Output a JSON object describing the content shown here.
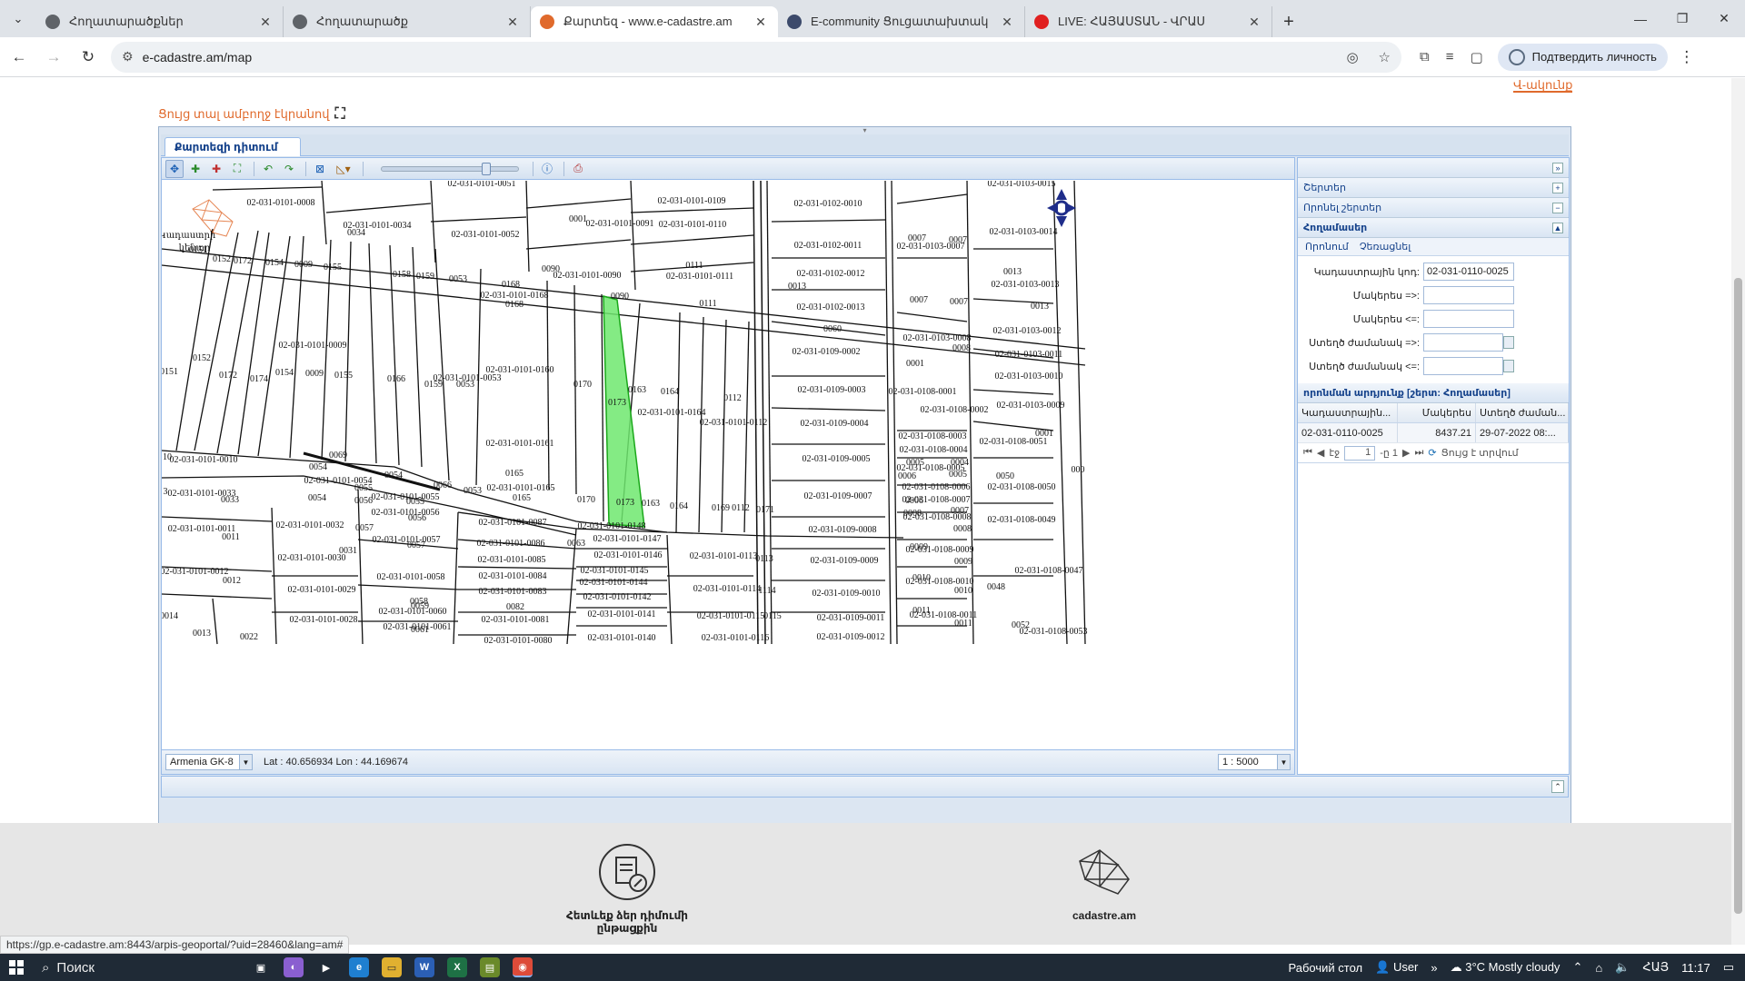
{
  "browser": {
    "tabs": [
      {
        "title": "Հողատարածքներ",
        "active": false,
        "color": "#5f6368"
      },
      {
        "title": "Հողատարածք",
        "active": false,
        "color": "#5f6368"
      },
      {
        "title": "Քարտեզ - www.e-cadastre.am",
        "active": true,
        "color": "#e06a2c"
      },
      {
        "title": "E-community Ցուցատախտակ",
        "active": false,
        "color": "#3c4a6b"
      },
      {
        "title": "LIVE: ՀԱՅԱՍՏԱՆ - ՎՐԱՍ",
        "active": false,
        "color": "#e02020"
      }
    ],
    "url": "e-cadastre.am/map",
    "verify_label": "Подтвердить личность",
    "status_url": "https://gp.e-cadastre.am:8443/arpis-geoportal/?uid=28460&lang=am#"
  },
  "page": {
    "top_link": "Վ-ակունք",
    "fullscreen_label": "Ցույց տալ ամբողջ էկրանով",
    "map_tab": "Քարտեզի դիտում",
    "projection": "Armenia GK-8",
    "latlon": "Lat : 40.656934  Lon : 44.169674",
    "scale": "1 : 5000"
  },
  "right_panel": {
    "sections": [
      {
        "label": "Շերտեր",
        "toggle": "+"
      },
      {
        "label": "Որոնել շերտեր",
        "toggle": "−"
      }
    ],
    "active_section": "Հողամասեր",
    "subtabs": [
      "Որոնում",
      "Չեռացնել"
    ],
    "fields": [
      {
        "label": "Կադաստրային կոդ:",
        "value": "02-031-0110-0025"
      },
      {
        "label": "Մակերես =>:",
        "value": ""
      },
      {
        "label": "Մակերես <=:",
        "value": ""
      },
      {
        "label": "Ստեղծ ժամանակ =>:",
        "value": ""
      },
      {
        "label": "Ստեղծ ժամանակ <=:",
        "value": ""
      }
    ],
    "results_title": "որոնման արդյունք [շերտ: Հողամասեր]",
    "columns": [
      "Կադաստրային...",
      "Մակերես",
      "Ստեղծ ժաման..."
    ],
    "rows": [
      [
        "02-031-0110-0025",
        "8437.21",
        "29-07-2022 08:..."
      ]
    ],
    "pager": {
      "page_label": "էջ",
      "page": "1",
      "of": "-ը 1",
      "status": "Ցույց է տրվում"
    }
  },
  "map": {
    "labels": [
      [
        "02-031-0101-0008",
        275,
        192
      ],
      [
        "02-031-0101-0051",
        496,
        171
      ],
      [
        "02-031-0101-0109",
        727,
        190
      ],
      [
        "02-031-0102-0010",
        877,
        193
      ],
      [
        "02-031-0103-0015",
        1090,
        171
      ],
      [
        "02-031-0101-0034",
        381,
        217
      ],
      [
        "0034",
        358,
        225
      ],
      [
        "0001",
        602,
        210
      ],
      [
        "02-031-0101-0091",
        648,
        215
      ],
      [
        "02-031-0101-0110",
        728,
        216
      ],
      [
        "02-031-0101-0052",
        500,
        227
      ],
      [
        "02-031-0103-0014",
        1092,
        224
      ],
      [
        "02-031-0102-0011",
        877,
        239
      ],
      [
        "0007",
        975,
        231
      ],
      [
        "0007",
        1020,
        233
      ],
      [
        "02-031-0103-0007",
        990,
        240
      ],
      [
        "0152",
        210,
        254
      ],
      [
        "0172",
        233,
        256
      ],
      [
        "0154",
        268,
        258
      ],
      [
        "0009",
        300,
        260
      ],
      [
        "0155",
        332,
        263
      ],
      [
        "0158",
        408,
        271
      ],
      [
        "0159",
        434,
        273
      ],
      [
        "0053",
        470,
        276
      ],
      [
        "0090",
        572,
        265
      ],
      [
        "02-031-0101-0090",
        612,
        272
      ],
      [
        "0111",
        730,
        261
      ],
      [
        "02-031-0101-0111",
        736,
        273
      ],
      [
        "02-031-0102-0012",
        880,
        270
      ],
      [
        "0013",
        1080,
        268
      ],
      [
        "0168",
        528,
        282
      ],
      [
        "02-031-0101-0168",
        532,
        294
      ],
      [
        "0168",
        532,
        304
      ],
      [
        "0090",
        648,
        295
      ],
      [
        "0111",
        745,
        303
      ],
      [
        "0013",
        843,
        284
      ],
      [
        "02-031-0103-0013",
        1094,
        282
      ],
      [
        "0007",
        977,
        299
      ],
      [
        "0007",
        1021,
        301
      ],
      [
        "02-031-0102-0013",
        880,
        307
      ],
      [
        "0013",
        1110,
        306
      ],
      [
        "02-031-0101-0009",
        310,
        349
      ],
      [
        "0060",
        882,
        331
      ],
      [
        "02-031-0103-0012",
        1096,
        333
      ],
      [
        "02-031-0103-0008",
        997,
        341
      ],
      [
        "0008",
        1024,
        352
      ],
      [
        "02-031-0109-0002",
        875,
        356
      ],
      [
        "0152",
        188,
        363
      ],
      [
        "0151",
        152,
        378
      ],
      [
        "0172",
        217,
        382
      ],
      [
        "0174",
        251,
        386
      ],
      [
        "0154",
        279,
        379
      ],
      [
        "0009",
        312,
        380
      ],
      [
        "0155",
        344,
        382
      ],
      [
        "0166",
        402,
        386
      ],
      [
        "02-031-0101-0160",
        538,
        376
      ],
      [
        "02-031-0101-0053",
        480,
        385
      ],
      [
        "0159",
        443,
        392
      ],
      [
        "0053",
        478,
        392
      ],
      [
        "02-031-0103-0011",
        1098,
        359
      ],
      [
        "0001",
        973,
        369
      ],
      [
        "02-031-0103-0010",
        1098,
        383
      ],
      [
        "0170",
        607,
        392
      ],
      [
        "0163",
        667,
        398
      ],
      [
        "0164",
        703,
        400
      ],
      [
        "0112",
        772,
        407
      ],
      [
        "02-031-0109-0003",
        881,
        398
      ],
      [
        "02-031-0108-0001",
        981,
        400
      ],
      [
        "0173",
        645,
        412
      ],
      [
        "02-031-0103-0009",
        1100,
        415
      ],
      [
        "02-031-0101-0164",
        705,
        423
      ],
      [
        "02-031-0101-0112",
        773,
        434
      ],
      [
        "02-031-0109-0004",
        884,
        435
      ],
      [
        "02-031-0108-0002",
        1016,
        420
      ],
      [
        "02-031-0108-0003",
        992,
        449
      ],
      [
        "02-031-0108-0004",
        993,
        464
      ],
      [
        "02-031-0101-0161",
        538,
        457
      ],
      [
        "0001",
        1115,
        446
      ],
      [
        "02-031-0108-0051",
        1081,
        455
      ],
      [
        "10",
        150,
        472
      ],
      [
        "02-031-0101-0010",
        190,
        475
      ],
      [
        "02-031-0109-0005",
        886,
        474
      ],
      [
        "0005",
        973,
        478
      ],
      [
        "0004",
        1022,
        478
      ],
      [
        "0069",
        338,
        470
      ],
      [
        "0054",
        316,
        483
      ],
      [
        "0054",
        399,
        492
      ],
      [
        "02-031-0101-0054",
        338,
        498
      ],
      [
        "0165",
        532,
        490
      ],
      [
        "02-031-0108-0005",
        990,
        484
      ],
      [
        "0050",
        1072,
        493
      ],
      [
        "0006",
        964,
        493
      ],
      [
        "0005",
        1020,
        491
      ],
      [
        "0055",
        366,
        506
      ],
      [
        "02-031-0101-0165",
        539,
        506
      ],
      [
        "0053",
        486,
        509
      ],
      [
        "02-031-0101-0033",
        188,
        512
      ],
      [
        "3",
        148,
        510
      ],
      [
        "0033",
        219,
        519
      ],
      [
        "02-031-0101-0055",
        412,
        516
      ],
      [
        "0066",
        453,
        503
      ],
      [
        "0054",
        315,
        517
      ],
      [
        "0056",
        366,
        520
      ],
      [
        "0055",
        423,
        521
      ],
      [
        "0165",
        540,
        517
      ],
      [
        "0170",
        611,
        519
      ],
      [
        "0173",
        654,
        522
      ],
      [
        "0163",
        682,
        523
      ],
      [
        "0164",
        713,
        526
      ],
      [
        "0169",
        759,
        528
      ],
      [
        "0112",
        781,
        528
      ],
      [
        "0171",
        808,
        530
      ],
      [
        "02-031-0109-0007",
        888,
        515
      ],
      [
        "02-031-0108-0006",
        996,
        505
      ],
      [
        "02-031-0108-0050",
        1090,
        505
      ],
      [
        "000",
        1152,
        486
      ],
      [
        "0007",
        1022,
        531
      ],
      [
        "02-031-0108-0007",
        996,
        519
      ],
      [
        "0006",
        972,
        520
      ],
      [
        "02-031-0101-0056",
        412,
        533
      ],
      [
        "02-031-0101-0087",
        530,
        544
      ],
      [
        "02-031-0101-0011",
        188,
        551
      ],
      [
        "02-031-0101-0032",
        307,
        547
      ],
      [
        "0057",
        367,
        550
      ],
      [
        "0056",
        425,
        539
      ],
      [
        "0011",
        220,
        560
      ],
      [
        "02-031-0101-0148",
        639,
        548
      ],
      [
        "02-031-0108-0008",
        997,
        538
      ],
      [
        "0008",
        1025,
        551
      ],
      [
        "02-031-0108-0049",
        1090,
        541
      ],
      [
        "0008",
        970,
        534
      ],
      [
        "02-031-0109-0008",
        893,
        552
      ],
      [
        "02-031-0101-0147",
        656,
        562
      ],
      [
        "02-031-0101-0057",
        413,
        563
      ],
      [
        "02-031-0101-0086",
        528,
        567
      ],
      [
        "0063",
        600,
        567
      ],
      [
        "0031",
        349,
        575
      ],
      [
        "0057",
        424,
        569
      ],
      [
        "02-031-0101-0030",
        309,
        583
      ],
      [
        "02-031-0101-0146",
        657,
        580
      ],
      [
        "02-031-0101-0085",
        529,
        585
      ],
      [
        "02-031-0101-0113",
        762,
        581
      ],
      [
        "0113",
        807,
        584
      ],
      [
        "02-031-0109-0009",
        895,
        586
      ],
      [
        "02-031-0108-0009",
        1000,
        574
      ],
      [
        "0009",
        1026,
        587
      ],
      [
        "0009",
        977,
        571
      ],
      [
        "02-031-0101-0012",
        180,
        598
      ],
      [
        "02-031-0101-0145",
        642,
        597
      ],
      [
        "02-031-0101-0058",
        418,
        604
      ],
      [
        "02-031-0101-0084",
        530,
        603
      ],
      [
        "0012",
        221,
        608
      ],
      [
        "02-031-0108-0047",
        1120,
        597
      ],
      [
        "02-031-0101-0144",
        641,
        610
      ],
      [
        "02-031-0101-0029",
        320,
        618
      ],
      [
        "02-031-0101-0083",
        530,
        620
      ],
      [
        "02-031-0101-0114",
        766,
        617
      ],
      [
        "1114",
        810,
        619
      ],
      [
        "02-031-0109-0010",
        897,
        622
      ],
      [
        "02-031-0108-0010",
        1000,
        609
      ],
      [
        "0010",
        1026,
        619
      ],
      [
        "0048",
        1062,
        615
      ],
      [
        "0010",
        980,
        605
      ],
      [
        "02-031-0101-0142",
        645,
        626
      ],
      [
        "0058",
        427,
        631
      ],
      [
        "0082",
        533,
        637
      ],
      [
        "0059",
        428,
        636
      ],
      [
        "02-031-0101-0060",
        420,
        642
      ],
      [
        "02-031-0101-0141",
        650,
        645
      ],
      [
        "02-031-0101-0115",
        770,
        647
      ],
      [
        "0115",
        816,
        647
      ],
      [
        "02-031-0109-0011",
        902,
        649
      ],
      [
        "02-031-0108-0011",
        1004,
        646
      ],
      [
        "0011",
        980,
        641
      ],
      [
        "0011",
        1026,
        655
      ],
      [
        "0014",
        152,
        647
      ],
      [
        "02-031-0101-0028",
        322,
        651
      ],
      [
        "02-031-0101-0081",
        533,
        651
      ],
      [
        "02-031-0101-0061",
        425,
        659
      ],
      [
        "0061",
        428,
        662
      ],
      [
        "0052",
        1089,
        657
      ],
      [
        "02-031-0108-0053",
        1125,
        664
      ],
      [
        "0013",
        188,
        666
      ],
      [
        "0022",
        240,
        670
      ],
      [
        "02-031-0101-0140",
        650,
        671
      ],
      [
        "02-031-0101-0116",
        775,
        671
      ],
      [
        "02-031-0109-0012",
        902,
        670
      ],
      [
        "02-031-0101-0080",
        536,
        674
      ]
    ],
    "side_labels": [
      [
        "Կադաստրի",
        172,
        228
      ],
      [
        "կենտր",
        180,
        242
      ],
      [
        "0151",
        184,
        244
      ]
    ]
  },
  "footer": {
    "items": [
      "Հետևեք ձեր դիմումի ընթացքին",
      "cadastre.am"
    ]
  },
  "taskbar": {
    "search": "Поиск",
    "desktop": "Рабочий стол",
    "user": "User",
    "weather": "3°C  Mostly cloudy",
    "lang": "ՀԱՅ",
    "time": "11:17"
  }
}
